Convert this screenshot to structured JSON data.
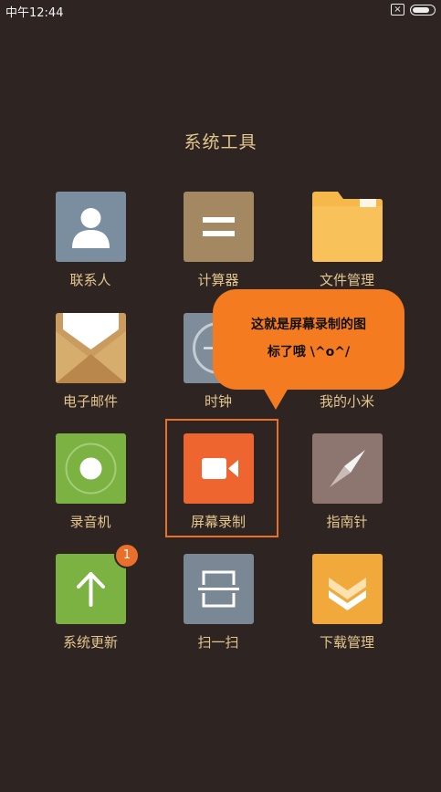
{
  "status_bar": {
    "time": "中午12:44"
  },
  "folder": {
    "title": "系统工具"
  },
  "apps": [
    {
      "label": "联系人",
      "icon": "contacts-icon"
    },
    {
      "label": "计算器",
      "icon": "calculator-icon"
    },
    {
      "label": "文件管理",
      "icon": "folder-icon"
    },
    {
      "label": "电子邮件",
      "icon": "email-icon"
    },
    {
      "label": "时钟",
      "icon": "clock-icon"
    },
    {
      "label": "我的小米",
      "icon": "mi-account-icon"
    },
    {
      "label": "录音机",
      "icon": "recorder-icon"
    },
    {
      "label": "屏幕录制",
      "icon": "screen-record-icon"
    },
    {
      "label": "指南针",
      "icon": "compass-icon"
    },
    {
      "label": "系统更新",
      "icon": "update-icon",
      "badge": "1"
    },
    {
      "label": "扫一扫",
      "icon": "scanner-icon"
    },
    {
      "label": "下载管理",
      "icon": "download-icon"
    }
  ],
  "callout": {
    "line1": "这就是屏幕录制的图",
    "line2": "标了哦  \\^o^/"
  },
  "colors": {
    "background": "#2e2523",
    "label": "#e3c58d",
    "accent": "#f47b20"
  }
}
